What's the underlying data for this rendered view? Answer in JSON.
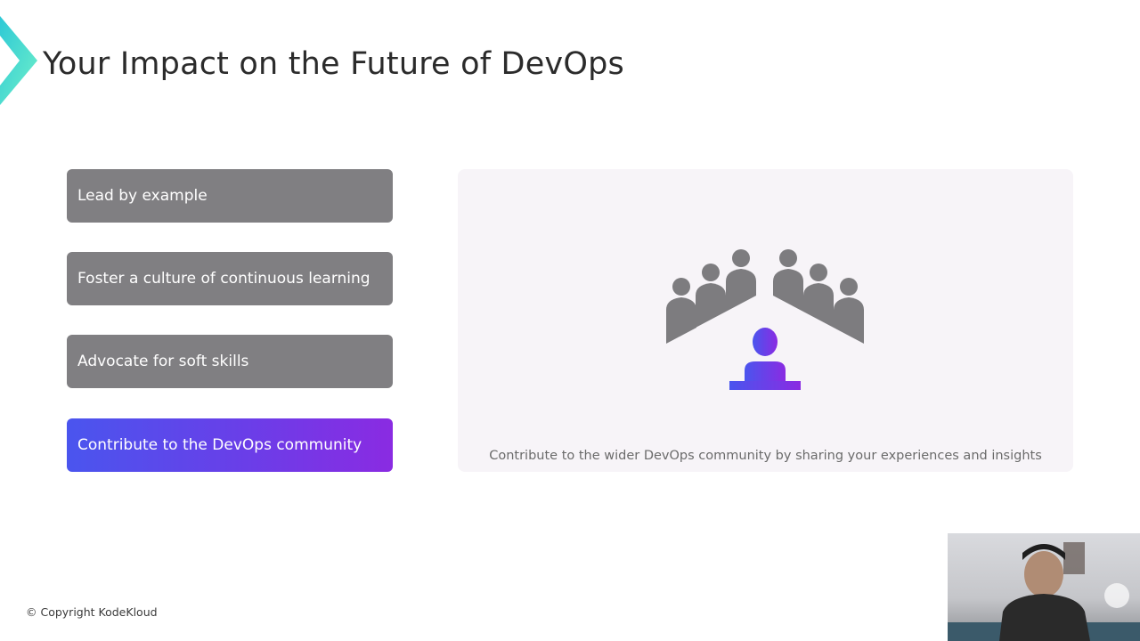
{
  "slide": {
    "title": "Your Impact on the Future of DevOps",
    "copyright": "© Copyright KodeKloud"
  },
  "menu": {
    "items": [
      {
        "label": "Lead by example",
        "active": false
      },
      {
        "label": "Foster a culture of continuous learning",
        "active": false
      },
      {
        "label": "Advocate for soft skills",
        "active": false
      },
      {
        "label": "Contribute to the DevOps community",
        "active": true
      }
    ]
  },
  "panel": {
    "caption": "Contribute to the wider DevOps community by sharing your experiences and insights",
    "illustration_icon": "audience-speaker-icon"
  },
  "colors": {
    "accent_start": "#4a55ee",
    "accent_end": "#8a2be2",
    "inactive_item": "#807f82",
    "panel_bg": "#f7f4f8",
    "logo_teal": "#3fd9d0",
    "audience_gray": "#7d7c7f"
  }
}
